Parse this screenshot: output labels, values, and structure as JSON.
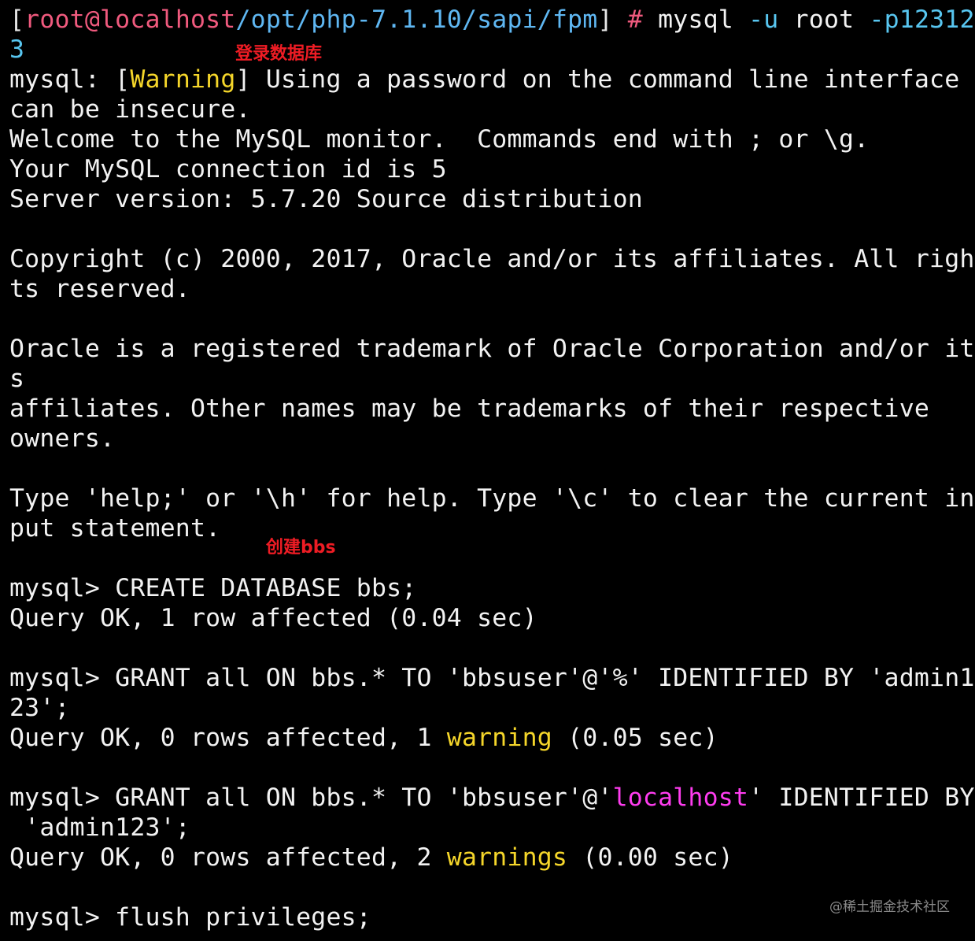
{
  "prompt": {
    "open_bracket": "[",
    "user_host": "root@localhost",
    "path": "/opt/php-7.1.10/sapi/fpm",
    "close_bracket": "]",
    "hash": " #",
    "command_name": " mysql ",
    "flag_u": "-u",
    "user_arg": " root ",
    "flag_p_first": "-p12312",
    "flag_p_wrap": "3"
  },
  "annotations": {
    "login": "登录数据库",
    "create_bbs": "创建bbs"
  },
  "output": {
    "warning_prefix": "mysql: [",
    "warning_word": "Warning",
    "warning_rest": "] Using a password on the command line interface",
    "warning_wrap": "can be insecure.",
    "welcome": "Welcome to the MySQL monitor.  Commands end with ; or \\g.",
    "connection_id": "Your MySQL connection id is 5",
    "server_version": "Server version: 5.7.20 Source distribution",
    "copyright_1": "Copyright (c) 2000, 2017, Oracle and/or its affiliates. All righ",
    "copyright_2": "ts reserved.",
    "trademark_1": "Oracle is a registered trademark of Oracle Corporation and/or it",
    "trademark_2": "s",
    "trademark_3": "affiliates. Other names may be trademarks of their respective",
    "trademark_4": "owners.",
    "help_1": "Type 'help;' or '\\h' for help. Type '\\c' to clear the current in",
    "help_2": "put statement."
  },
  "session": {
    "create_cmd": "mysql> CREATE DATABASE bbs;",
    "create_result": "Query OK, 1 row affected (0.04 sec)",
    "grant1_cmd_1": "mysql> GRANT all ON bbs.* TO 'bbsuser'@'%' IDENTIFIED BY 'admin1",
    "grant1_cmd_2": "23';",
    "grant1_result_a": "Query OK, 0 rows affected, 1 ",
    "grant1_result_warn": "warning",
    "grant1_result_b": " (0.05 sec)",
    "grant2_cmd_a": "mysql> GRANT all ON bbs.* TO 'bbsuser'@'",
    "grant2_cmd_host": "localhost",
    "grant2_cmd_b": "' IDENTIFIED BY",
    "grant2_cmd_2": " 'admin123';",
    "grant2_result_a": "Query OK, 0 rows affected, 2 ",
    "grant2_result_warn": "warnings",
    "grant2_result_b": " (0.00 sec)",
    "flush_cmd": "mysql> flush privileges;"
  },
  "watermark": "@稀土掘金技术社区",
  "colors": {
    "background": "#000000",
    "text": "#f2f2f2",
    "prompt_user": "#f05a7e",
    "prompt_path": "#5fb7f2",
    "warning": "#f5d62a",
    "host_highlight": "#ff3cf0",
    "annotation": "#ee1c24"
  }
}
